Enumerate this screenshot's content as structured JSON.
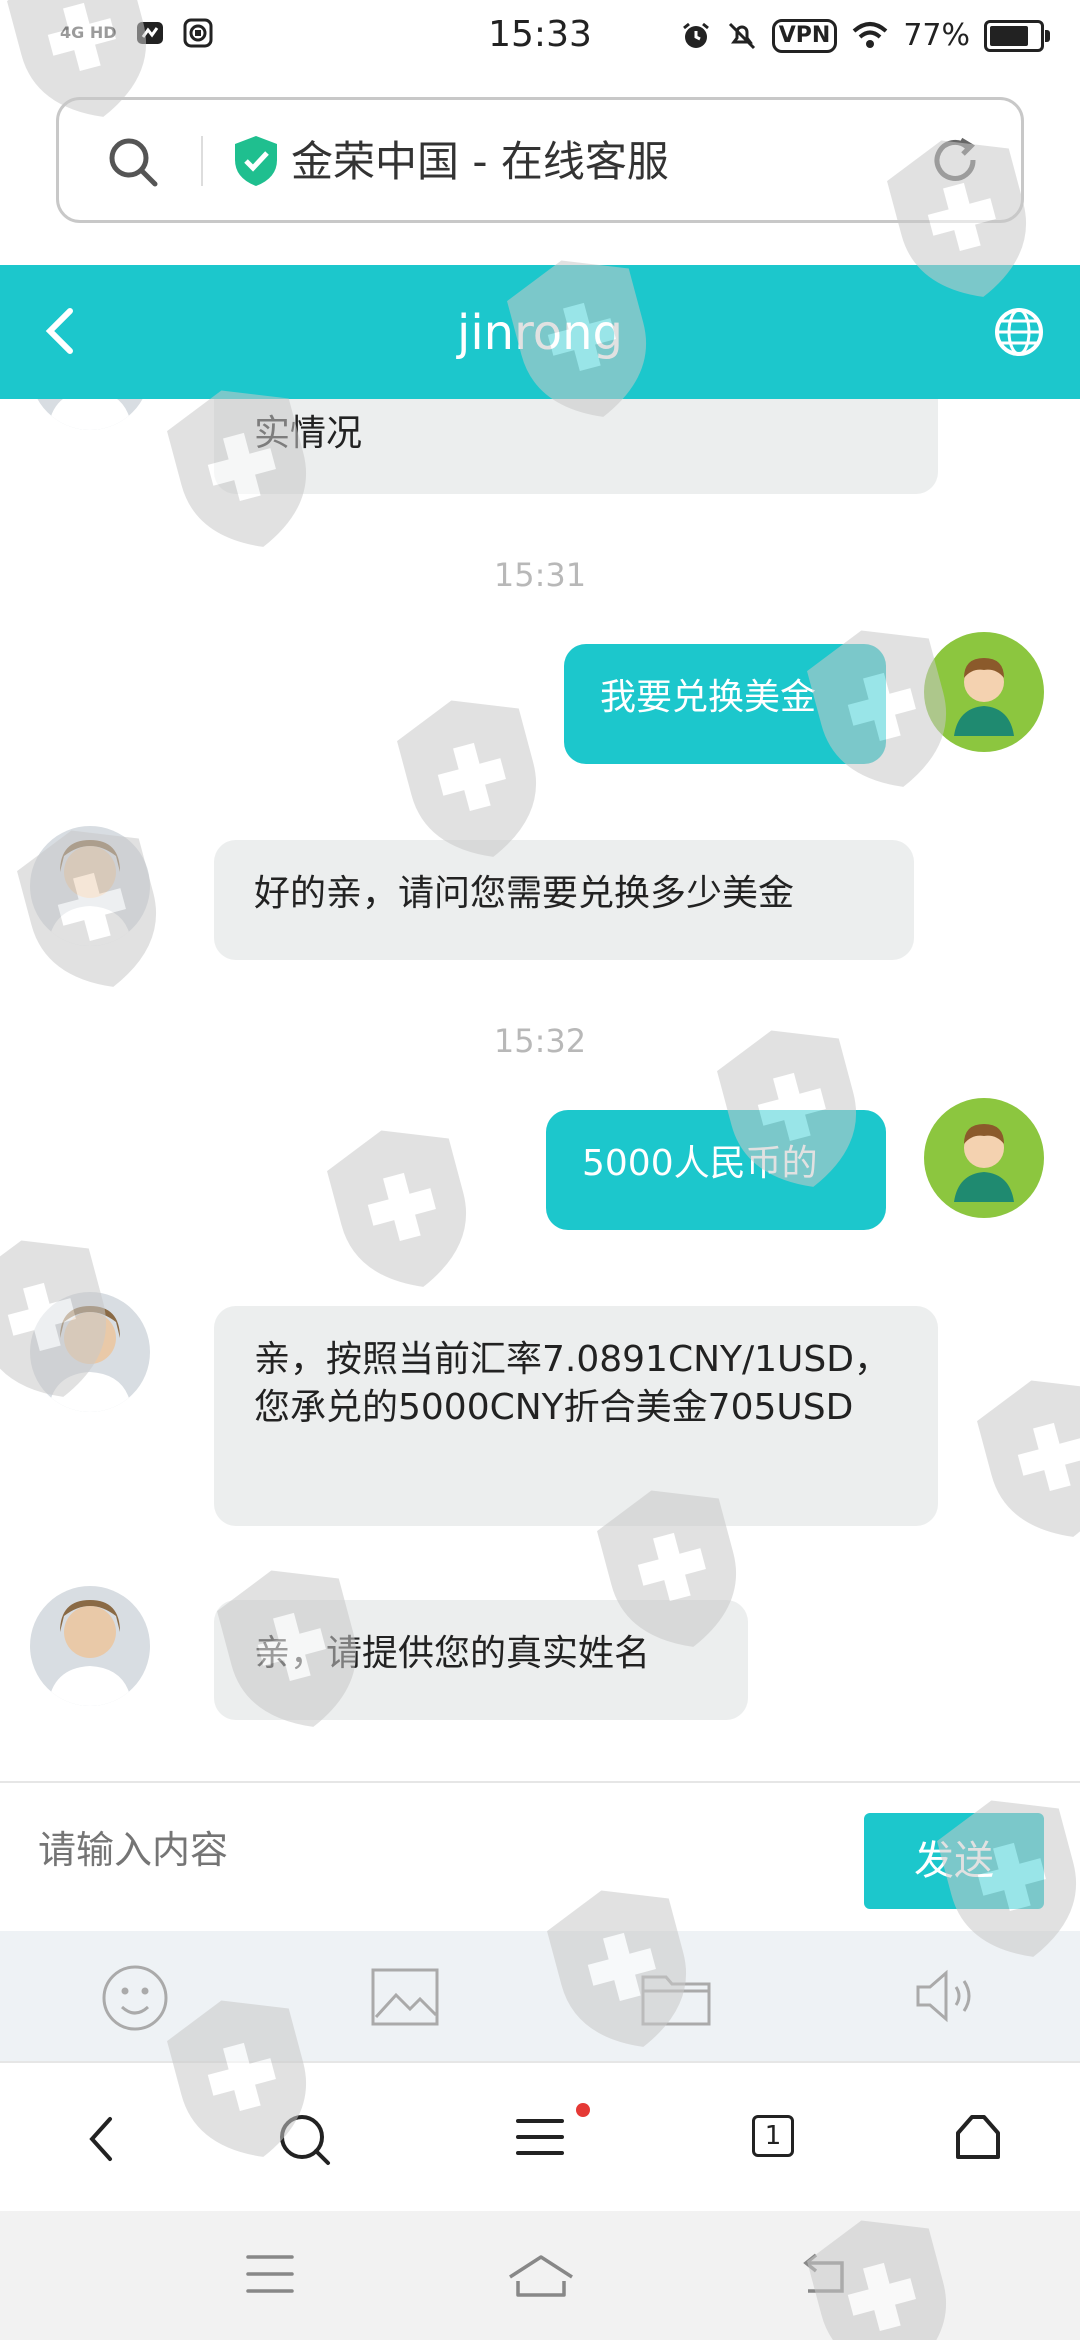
{
  "status_bar": {
    "time": "15:33",
    "network_type": "4G HD",
    "vpn_label": "VPN",
    "battery": "77%",
    "icons": [
      "signal-icon",
      "message-app-icon",
      "bank-app-icon",
      "alarm-icon",
      "mute-icon",
      "wifi-icon",
      "battery-icon"
    ]
  },
  "url_bar": {
    "title": "金荣中国 - 在线客服",
    "icons": [
      "search-icon",
      "verified-shield-icon",
      "reload-icon"
    ]
  },
  "chat_header": {
    "title": "jinrong",
    "icons": [
      "back-icon",
      "globe-icon"
    ]
  },
  "messages": [
    {
      "sender": "agent",
      "text": "实情况",
      "partial": true
    },
    {
      "type": "timestamp",
      "text": "15:31"
    },
    {
      "sender": "user",
      "text": "我要兑换美金"
    },
    {
      "sender": "agent",
      "text": "好的亲，请问您需要兑换多少美金"
    },
    {
      "type": "timestamp",
      "text": "15:32"
    },
    {
      "sender": "user",
      "text": "5000人民币的"
    },
    {
      "sender": "agent",
      "text": "亲，按照当前汇率7.0891CNY/1USD，您承兑的5000CNY折合美金705USD"
    },
    {
      "sender": "agent",
      "text": "亲，请提供您的真实姓名"
    }
  ],
  "input_bar": {
    "placeholder": "请输入内容",
    "send_label": "发送"
  },
  "tool_row": {
    "icons": [
      "emoji-icon",
      "image-icon",
      "folder-icon",
      "voice-icon"
    ]
  },
  "browser_nav": {
    "tab_count": "1",
    "icons": [
      "back-icon",
      "search-icon",
      "menu-icon",
      "tabs-icon",
      "home-icon"
    ]
  },
  "system_nav": {
    "icons": [
      "recent-apps-icon",
      "home-icon",
      "back-icon"
    ]
  },
  "colors": {
    "accent": "#1cc7cc",
    "incoming_bubble": "#eceeee",
    "timestamp": "#b8b8b8",
    "notification_dot": "#e53935"
  }
}
